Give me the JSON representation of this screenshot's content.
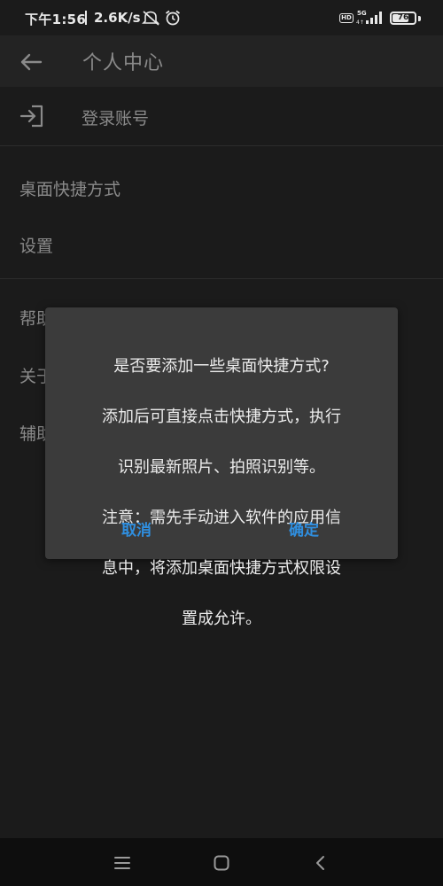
{
  "status_bar": {
    "time": "下午1:56",
    "net_speed": "2.6K/s",
    "network_type": "5G",
    "hd_label": "HD",
    "battery_level": "76",
    "icons": [
      "mute-icon",
      "alarm-icon",
      "hd-icon",
      "signal-icon",
      "battery-icon"
    ]
  },
  "app_bar": {
    "title": "个人中心",
    "back_icon": "arrow-left-icon"
  },
  "list": {
    "login": {
      "label": "登录账号",
      "icon": "login-icon"
    },
    "items": [
      {
        "label": "桌面快捷方式"
      },
      {
        "label": "设置"
      },
      {
        "label": "帮助"
      },
      {
        "label": "关于"
      },
      {
        "label": "辅助"
      }
    ]
  },
  "dialog": {
    "message": "是否要添加一些桌面快捷方式?\n添加后可直接点击快捷方式，执行识别最新照片、拍照识别等。\n注意：需先手动进入软件的应用信息中，将添加桌面快捷方式权限设置成允许。",
    "message_lines": [
      "是否要添加一些桌面快捷方式?",
      "添加后可直接点击快捷方式，执行",
      "识别最新照片、拍照识别等。",
      "注意：需先手动进入软件的应用信",
      "息中，将添加桌面快捷方式权限设",
      "置成允许。"
    ],
    "cancel_label": "取消",
    "ok_label": "确定",
    "accent_color": "#2f8fe0"
  },
  "nav_bar": {
    "icons": [
      "menu-icon",
      "home-icon",
      "back-icon"
    ]
  }
}
